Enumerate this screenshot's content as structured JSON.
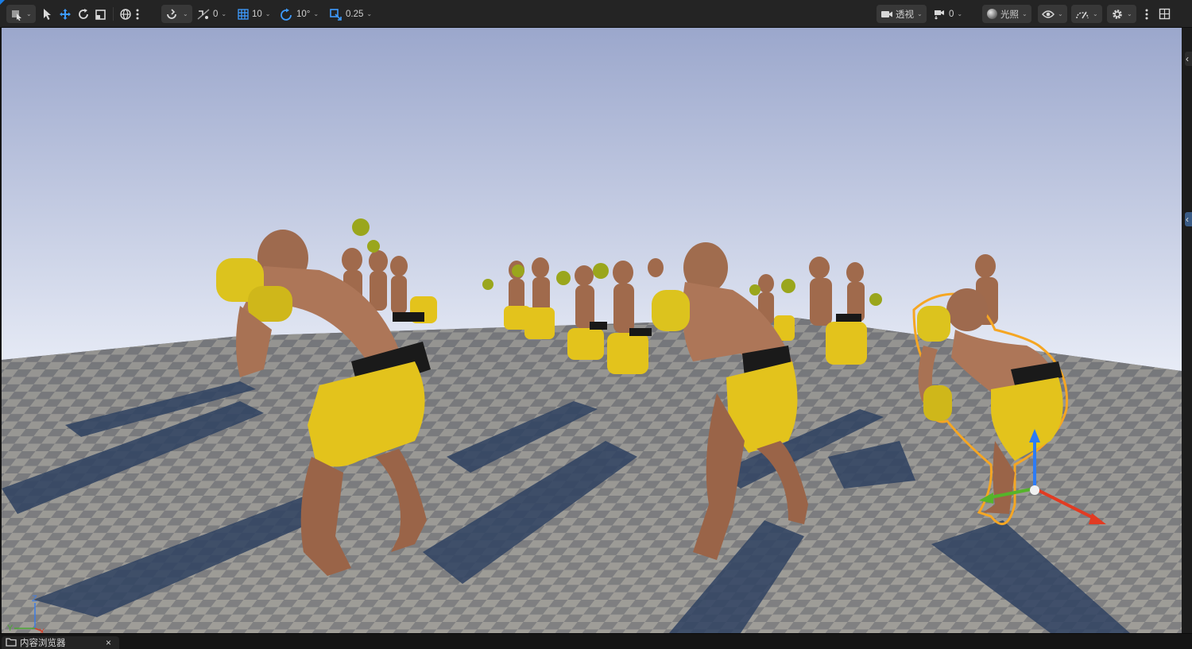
{
  "toolbar": {
    "select_mode_icon": "select-mode-icon",
    "snap_surface_value": "0",
    "grid_snap_value": "10",
    "rotation_snap_value": "10°",
    "scale_snap_value": "0.25",
    "view_mode_label": "透视",
    "camera_speed_value": "0",
    "lighting_label": "光照",
    "accent_color": "#1a7ee6"
  },
  "viewport": {
    "sky_top_color": "#9ba7cc",
    "sky_bottom_color": "#e9edf7",
    "selection_outline_color": "#f5a623",
    "axis_labels": {
      "z": "Z",
      "y": "Y",
      "x": "X"
    }
  },
  "bottom": {
    "content_browser_tab": "内容浏览器",
    "close_glyph": "×"
  }
}
